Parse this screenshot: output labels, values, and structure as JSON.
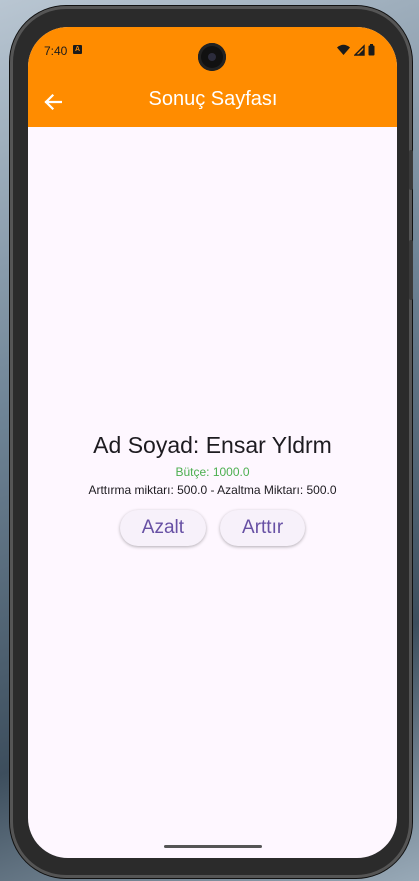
{
  "status_bar": {
    "time": "7:40",
    "notification_icon": "A"
  },
  "app_bar": {
    "title": "Sonuç Sayfası",
    "back_icon": "arrow-left-icon",
    "color": "#ff8c00"
  },
  "content": {
    "name_line": "Ad Soyad: Ensar Yldrm",
    "budget_line": "Bütçe: 1000.0",
    "amounts_line": "Arttırma miktarı: 500.0 - Azaltma Miktarı: 500.0",
    "decrease_button": "Azalt",
    "increase_button": "Arttır"
  },
  "colors": {
    "budget_text": "#4caf50",
    "button_text": "#6750a4",
    "background": "#fef7ff"
  }
}
